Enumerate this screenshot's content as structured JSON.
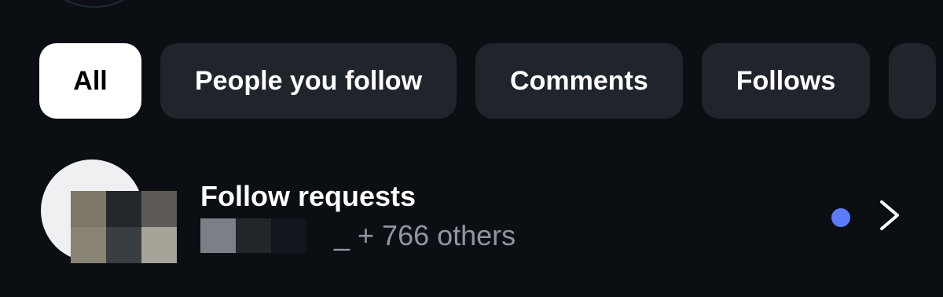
{
  "filters": {
    "chips": [
      {
        "label": "All",
        "selected": true
      },
      {
        "label": "People you follow",
        "selected": false
      },
      {
        "label": "Comments",
        "selected": false
      },
      {
        "label": "Follows",
        "selected": false
      }
    ]
  },
  "follow_requests": {
    "title": "Follow requests",
    "subtitle_suffix": "_ + 766 others",
    "unread_indicator": true,
    "icons": {
      "avatar": "avatar-icon",
      "unread": "unread-dot-icon",
      "chevron": "chevron-right-icon"
    }
  },
  "colors": {
    "background": "#0b0f14",
    "chip_bg": "#20252b",
    "chip_active_bg": "#ffffff",
    "subtext": "#8e969e",
    "unread_dot": "#5b7cff"
  }
}
